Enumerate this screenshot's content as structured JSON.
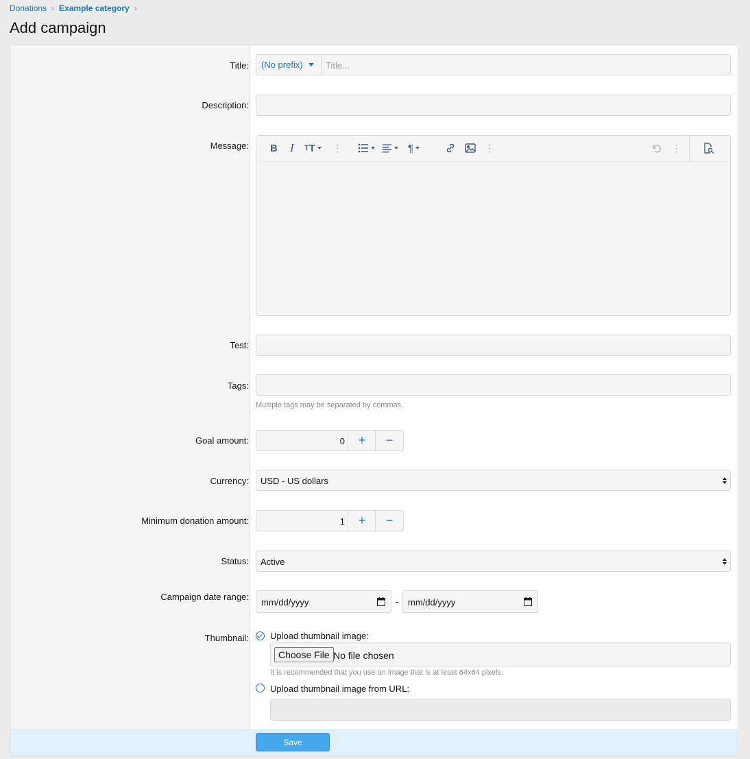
{
  "breadcrumb": {
    "items": [
      "Donations",
      "Example category"
    ]
  },
  "page_title": "Add campaign",
  "form": {
    "title": {
      "label": "Title:",
      "prefix": "(No prefix)",
      "placeholder": "Title..."
    },
    "description": {
      "label": "Description:"
    },
    "message": {
      "label": "Message:"
    },
    "test": {
      "label": "Test:"
    },
    "tags": {
      "label": "Tags:",
      "hint": "Multiple tags may be separated by commas."
    },
    "goal_amount": {
      "label": "Goal amount:",
      "value": "0"
    },
    "currency": {
      "label": "Currency:",
      "value": "USD - US dollars"
    },
    "min_donation": {
      "label": "Minimum donation amount:",
      "value": "1"
    },
    "status": {
      "label": "Status:",
      "value": "Active"
    },
    "date_range": {
      "label": "Campaign date range:",
      "start_placeholder": "mm/dd/yyyy",
      "end_placeholder": "mm/dd/yyyy",
      "separator": "-"
    },
    "thumbnail": {
      "label": "Thumbnail:",
      "upload_label": "Upload thumbnail image:",
      "choose_file": "Choose File",
      "no_file": "No file chosen",
      "upload_hint": "It is recommended that you use an image that is at least 64x64 pixels.",
      "url_label": "Upload thumbnail image from URL:"
    }
  },
  "save_label": "Save",
  "colors": {
    "link": "#2577b1",
    "save": "#47a7eb",
    "submit_row": "#e2f0fb"
  }
}
